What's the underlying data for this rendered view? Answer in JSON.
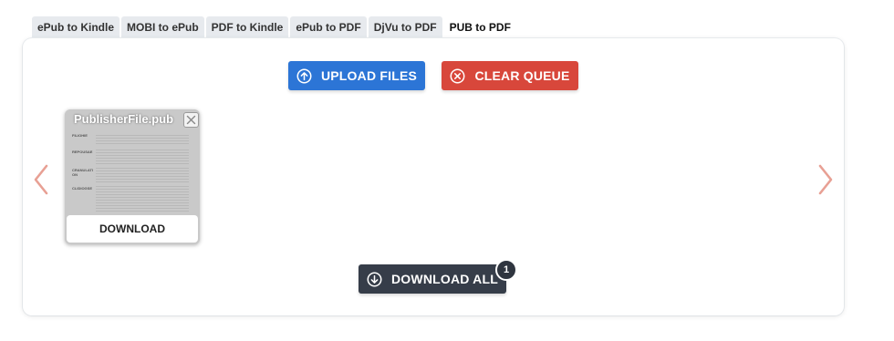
{
  "tabs": [
    {
      "label": "ePub to Kindle"
    },
    {
      "label": "MOBI to ePub"
    },
    {
      "label": "PDF to Kindle"
    },
    {
      "label": "ePub to PDF"
    },
    {
      "label": "DjVu to PDF"
    },
    {
      "label": "PUB to PDF",
      "active": true
    }
  ],
  "toolbar": {
    "upload_label": "UPLOAD FILES",
    "clear_label": "CLEAR QUEUE"
  },
  "file_card": {
    "filename": "PublisherFile.pub",
    "download_label": "DOWNLOAD",
    "thumbnail_labels": [
      "FILIOHIE",
      "REPOUSAE",
      "CRANULATI ON",
      "CLIDIOGSE"
    ]
  },
  "download_all": {
    "label": "DOWNLOAD ALL",
    "count": "1"
  },
  "colors": {
    "upload": "#2c75d6",
    "clear": "#d8473b",
    "download_all": "#363d49",
    "arrow": "#e8a094"
  },
  "icons": {
    "upload": "arrow-up-circle-icon",
    "clear": "x-circle-icon",
    "download_all": "arrow-down-circle-icon",
    "prev": "chevron-left-icon",
    "next": "chevron-right-icon",
    "remove": "close-icon"
  }
}
